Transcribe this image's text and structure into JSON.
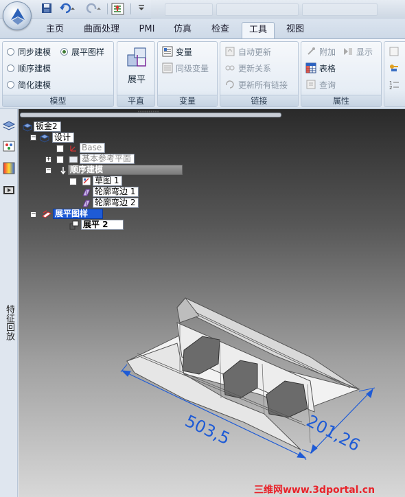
{
  "quick_access": {
    "icons": [
      "save-icon",
      "undo-icon",
      "redo-icon",
      "select-icon",
      "customize-icon"
    ]
  },
  "ribbon_tabs": [
    {
      "label": "主页",
      "active": false
    },
    {
      "label": "曲面处理",
      "active": false
    },
    {
      "label": "PMI",
      "active": false
    },
    {
      "label": "仿真",
      "active": false
    },
    {
      "label": "检查",
      "active": false
    },
    {
      "label": "工具",
      "active": true
    },
    {
      "label": "视图",
      "active": false
    }
  ],
  "groups": {
    "model": {
      "label": "模型",
      "sync": "同步建模",
      "flat_pattern": "展平图样",
      "ordered": "顺序建模",
      "simplified": "简化建模"
    },
    "flatten": {
      "label": "平直",
      "button": "展平"
    },
    "variable": {
      "label": "变量",
      "variable": "变量",
      "sub_variable": "同级变量"
    },
    "links": {
      "label": "链接",
      "auto_update": "自动更新",
      "update_relations": "更新关系",
      "update_all_links": "更新所有链接"
    },
    "properties": {
      "label": "属性",
      "attach": "附加",
      "show": "显示",
      "table": "表格",
      "query": "查询"
    }
  },
  "side_tab_label": "特征回放",
  "tree": {
    "root": "钣金2",
    "design": "设计",
    "base": "Base",
    "ref_planes": "基本参考平面",
    "ordered_modeling": "顺序建模",
    "sketch": "草图 1",
    "flange1": "轮廓弯边 1",
    "flange2": "轮廓弯边 2",
    "flat_pattern": "展平图样",
    "flat": "展平 2"
  },
  "dimensions": {
    "length": "503,5",
    "width": "201,26"
  },
  "watermark": "三维网www.3dportal.cn",
  "colors": {
    "dimension": "#1e5bd6",
    "highlight": "#1e5bd6",
    "watermark": "#e8232a"
  }
}
